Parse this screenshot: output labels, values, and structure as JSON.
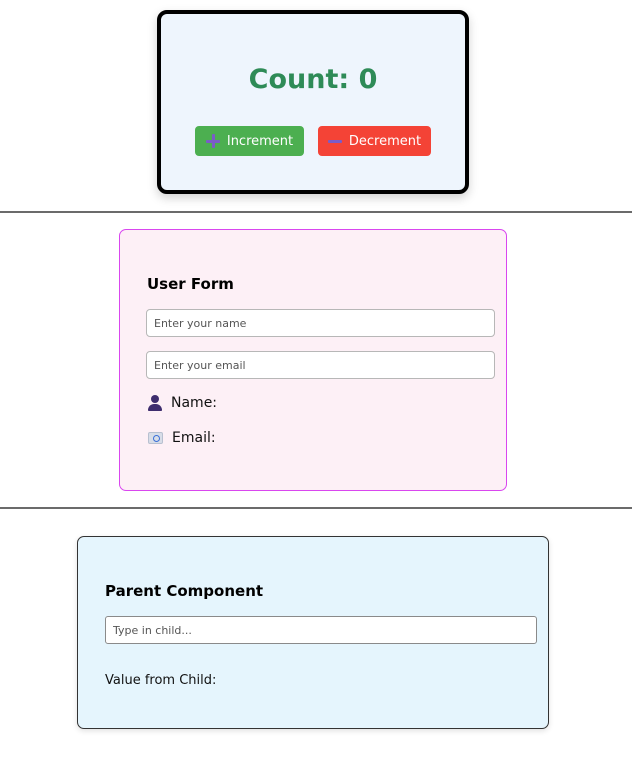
{
  "counter": {
    "label": "Count: ",
    "value": "0",
    "increment_label": "Increment",
    "decrement_label": "Decrement",
    "increment_icon": "plus-icon",
    "decrement_icon": "minus-icon",
    "title_color": "#2e8b57",
    "increment_color": "#4caf50",
    "decrement_color": "#f44336"
  },
  "user_form": {
    "title": "User Form",
    "name_placeholder": "Enter your name",
    "email_placeholder": "Enter your email",
    "name_label": "Name:",
    "email_label": "Email:",
    "name_icon": "person-icon",
    "email_icon": "envelope-icon",
    "accent_color": "#d946ef"
  },
  "parent_component": {
    "title": "Parent Component",
    "child_placeholder": "Type in child...",
    "value_label": "Value from Child:"
  }
}
